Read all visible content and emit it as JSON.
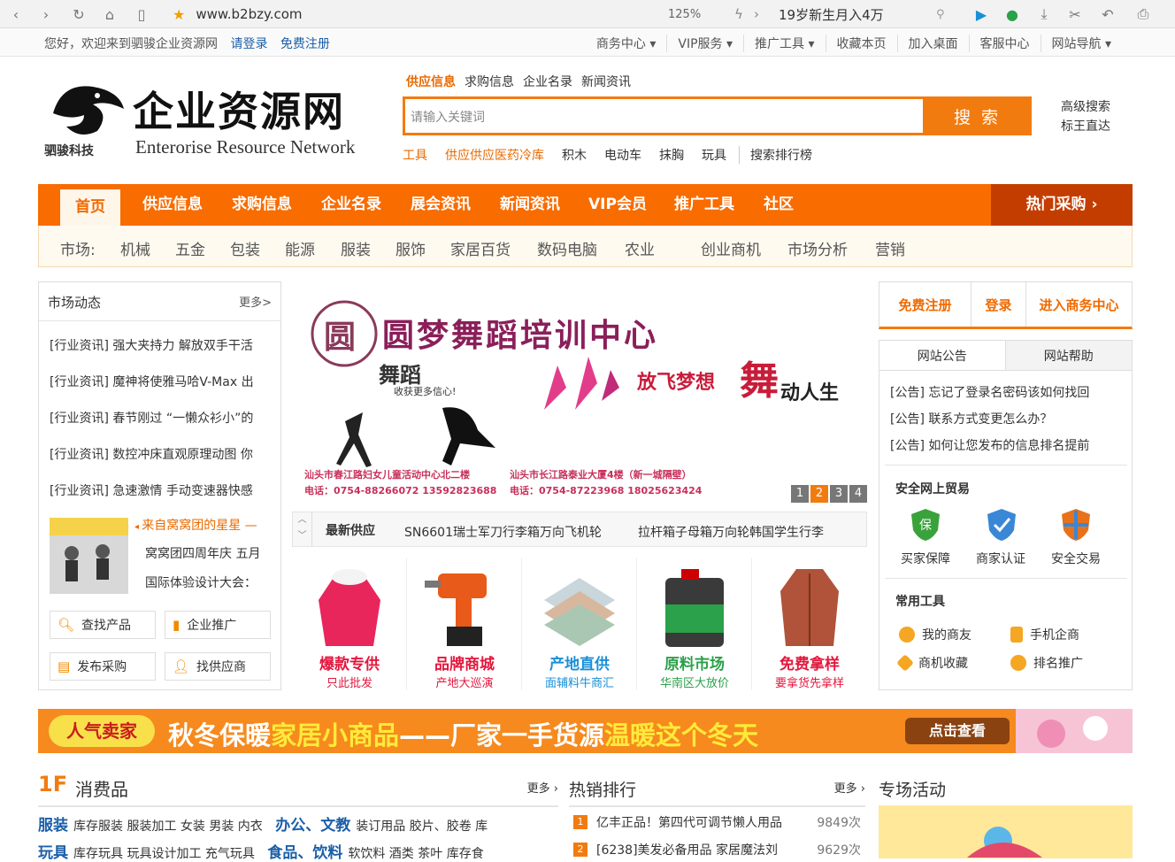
{
  "browser": {
    "url": "www.b2bzy.com",
    "zoom": "125%",
    "search_text": "19岁新生月入4万"
  },
  "topbar": {
    "welcome": "您好，欢迎来到驷骏企业资源网",
    "login": "请登录",
    "register": "免费注册",
    "links": [
      "商务中心 ▾",
      "VIP服务 ▾",
      "推广工具 ▾",
      "收藏本页",
      "加入桌面",
      "客服中心",
      "网站导航 ▾"
    ]
  },
  "logo": {
    "title": "企业资源网",
    "subtitle": "Enterorise Resource Network",
    "brand": "驷骏科技"
  },
  "search": {
    "tabs": [
      "供应信息",
      "求购信息",
      "企业名录",
      "新闻资讯"
    ],
    "placeholder": "请输入关键词",
    "button": "搜 索",
    "advanced": "高级搜索",
    "bid": "标王直达",
    "hot": [
      "工具",
      "供应供应医药冷库",
      "积木",
      "电动车",
      "抹胸",
      "玩具",
      "搜索排行榜"
    ]
  },
  "nav": {
    "items": [
      "首页",
      "供应信息",
      "求购信息",
      "企业名录",
      "展会资讯",
      "新闻资讯",
      "VIP会员",
      "推广工具",
      "社区"
    ],
    "hotbuy": "热门采购 ›"
  },
  "market": {
    "label": "市场:",
    "items": [
      "机械",
      "五金",
      "包装",
      "能源",
      "服装",
      "服饰",
      "家居百货",
      "数码电脑",
      "农业",
      "创业商机",
      "市场分析",
      "营销"
    ]
  },
  "left": {
    "title": "市场动态",
    "more": "更多>",
    "news": [
      "[行业资讯] 强大夹持力 解放双手干活",
      "[行业资讯] 魔神将使雅马哈V-Max 出",
      "[行业资讯] 春节刚过 “一懒众衫小”的",
      "[行业资讯] 数控冲床直观原理动图 你",
      "[行业资讯] 急速激情 手动变速器快感"
    ],
    "feature_title": "来自窝窝团的星星 —",
    "feature_text1": "窝窝团四周年庆 五月",
    "feature_text2": "国际体验设计大会：",
    "buttons": [
      "查找产品",
      "企业推广",
      "发布采购",
      "找供应商"
    ]
  },
  "banner": {
    "title": "圆梦舞蹈培训中心",
    "logo_char": "圆",
    "sub1": "舞蹈",
    "sub2": "收获更多信心!",
    "slogan_a": "放飞梦想",
    "slogan_b": "舞",
    "slogan_c": "动人生",
    "addr1": "汕头市春江路妇女儿童活动中心北二楼",
    "addr2": "汕头市长江路泰业大厦4楼（新一城隔壁）",
    "tel1": "电话：0754-88266072  13592823688",
    "tel2": "电话：0754-87223968  18025623424",
    "pages": [
      "1",
      "2",
      "3",
      "4"
    ]
  },
  "ticker": {
    "label": "最新供应",
    "items": [
      "SN6601瑞士军刀行李箱万向飞机轮",
      "拉杆箱子母箱万向轮韩国学生行李"
    ]
  },
  "products": [
    {
      "t1": "爆款专供",
      "t2": "只此批发",
      "c1": "#e3173d",
      "c2": "#e3173d"
    },
    {
      "t1": "品牌商城",
      "t2": "产地大巡演",
      "c1": "#e3173d",
      "c2": "#e3173d"
    },
    {
      "t1": "产地直供",
      "t2": "面辅料牛商汇",
      "c1": "#1a8fd6",
      "c2": "#1a8fd6"
    },
    {
      "t1": "原料市场",
      "t2": "华南区大放价",
      "c1": "#2aa14a",
      "c2": "#2aa14a"
    },
    {
      "t1": "免费拿样",
      "t2": "要拿货先拿样",
      "c1": "#e3173d",
      "c2": "#e3173d"
    }
  ],
  "right": {
    "buttons": [
      "免费注册",
      "登录",
      "进入商务中心"
    ],
    "tabs": [
      "网站公告",
      "网站帮助"
    ],
    "notices": [
      "[公告] 忘记了登录名密码该如何找回",
      "[公告] 联系方式变更怎么办？",
      "[公告] 如何让您发布的信息排名提前"
    ],
    "safe_title": "安全网上贸易",
    "safe": [
      "买家保障",
      "商家认证",
      "安全交易"
    ],
    "tools_title": "常用工具",
    "tools": [
      "我的商友",
      "手机企商",
      "商机收藏",
      "排名推广"
    ]
  },
  "ad": {
    "tag": "人气卖家",
    "text_a": "秋冬保暖",
    "text_b": "家居小商品",
    "text_c": "——厂家一手货源",
    "text_d": "温暖这个冬天",
    "button": "点击查看"
  },
  "floor": {
    "num": "1F",
    "title": "消费品",
    "more": "更多 ›",
    "rows": [
      {
        "a": "服装",
        "a_items": "库存服装 服装加工 女装 男装 内衣",
        "b": "办公、文教",
        "b_items": "装订用品 胶片、胶卷 库"
      },
      {
        "a": "玩具",
        "a_items": "库存玩具 玩具设计加工 充气玩具",
        "b": "食品、饮料",
        "b_items": "软饮料 酒类 茶叶 库存食"
      }
    ]
  },
  "ranking": {
    "title": "热销排行",
    "more": "更多 ›",
    "items": [
      {
        "n": "1",
        "text": "亿丰正品！第四代可调节懒人用品",
        "count": "9849次"
      },
      {
        "n": "2",
        "text": "[6238]美发必备用品 家居魔法刘",
        "count": "9629次"
      }
    ]
  },
  "special": {
    "title": "专场活动"
  },
  "colors": {
    "accent": "#f27b10",
    "nav": "#f86c00",
    "link": "#1b5fa8"
  }
}
